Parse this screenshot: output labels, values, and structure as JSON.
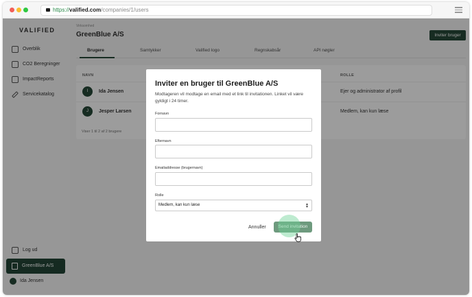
{
  "browser": {
    "url_protocol": "https://",
    "url_host": "valified.com",
    "url_path": "/companies/1/users"
  },
  "sidebar": {
    "logo": "VALIFIED",
    "items": [
      {
        "label": "Overblik",
        "icon": "dashboard-icon"
      },
      {
        "label": "CO2 Beregninger",
        "icon": "clipboard-check-icon"
      },
      {
        "label": "ImpactReports",
        "icon": "report-icon"
      },
      {
        "label": "Servicekatalog",
        "icon": "tools-icon"
      }
    ],
    "logout_label": "Log ud",
    "company_label": "GreenBlue A/S",
    "user_name": "Ida Jensen"
  },
  "main": {
    "breadcrumb": "Virksomhed",
    "title": "GreenBlue A/S",
    "invite_button": "Inviter bruger",
    "tabs": [
      "Brugere",
      "Samtykker",
      "Valified logo",
      "Regnskabsår",
      "API nøgler"
    ],
    "table": {
      "col_name": "NAVN",
      "col_role": "ROLLE",
      "rows": [
        {
          "initial": "I",
          "name": "Ida Jensen",
          "role": "Ejer og administrator af profil"
        },
        {
          "initial": "J",
          "name": "Jesper Larsen",
          "role": "Medlem, kan kun læse"
        }
      ],
      "footer": "Viser 1 til 2 af 2 brugere"
    }
  },
  "modal": {
    "title": "Inviter en bruger til GreenBlue A/S",
    "description": "Modtageren vil modtage en email med et link til invitationen. Linket vil være gyldigt i 24 timer.",
    "firstname_label": "Fornavn",
    "firstname_value": "",
    "lastname_label": "Efternavn",
    "lastname_value": "",
    "email_label": "Emailaddresse (brugernavn)",
    "email_value": "",
    "role_label": "Rolle",
    "role_value": "Medlem, kan kun læse",
    "cancel_label": "Annuller",
    "send_label": "Send invitation"
  },
  "colors": {
    "brand_dark_green": "#133826",
    "send_button_green": "#6e9a7e"
  }
}
